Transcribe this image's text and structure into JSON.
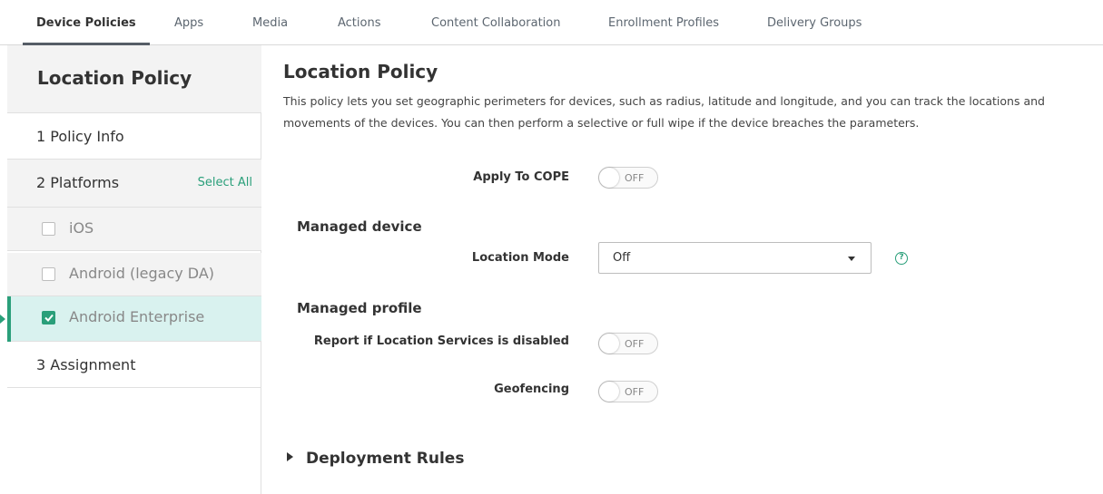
{
  "tabs": [
    "Device Policies",
    "Apps",
    "Media",
    "Actions",
    "Content Collaboration",
    "Enrollment Profiles",
    "Delivery Groups"
  ],
  "sidebar": {
    "title": "Location Policy",
    "step1": "1  Policy Info",
    "step2": "2  Platforms",
    "select_all": "Select All",
    "platforms": [
      "iOS",
      "Android (legacy DA)",
      "Android Enterprise"
    ],
    "step3": "3  Assignment"
  },
  "main": {
    "title": "Location Policy",
    "description": "This policy lets you set geographic perimeters for devices, such as radius, latitude and longitude, and you can track the locations and movements of the devices. You can then perform a selective or full wipe if the device breaches the parameters.",
    "apply_cope_label": "Apply To COPE",
    "apply_cope_value": "OFF",
    "managed_device": "Managed device",
    "location_mode_label": "Location Mode",
    "location_mode_value": "Off",
    "help": "?",
    "managed_profile": "Managed profile",
    "report_label": "Report if Location Services is disabled",
    "report_value": "OFF",
    "geofencing_label": "Geofencing",
    "geofencing_value": "OFF",
    "deployment_rules": "Deployment Rules"
  },
  "colors": {
    "accent": "#2a9f7a",
    "selected_row": "#d9f2ef"
  }
}
